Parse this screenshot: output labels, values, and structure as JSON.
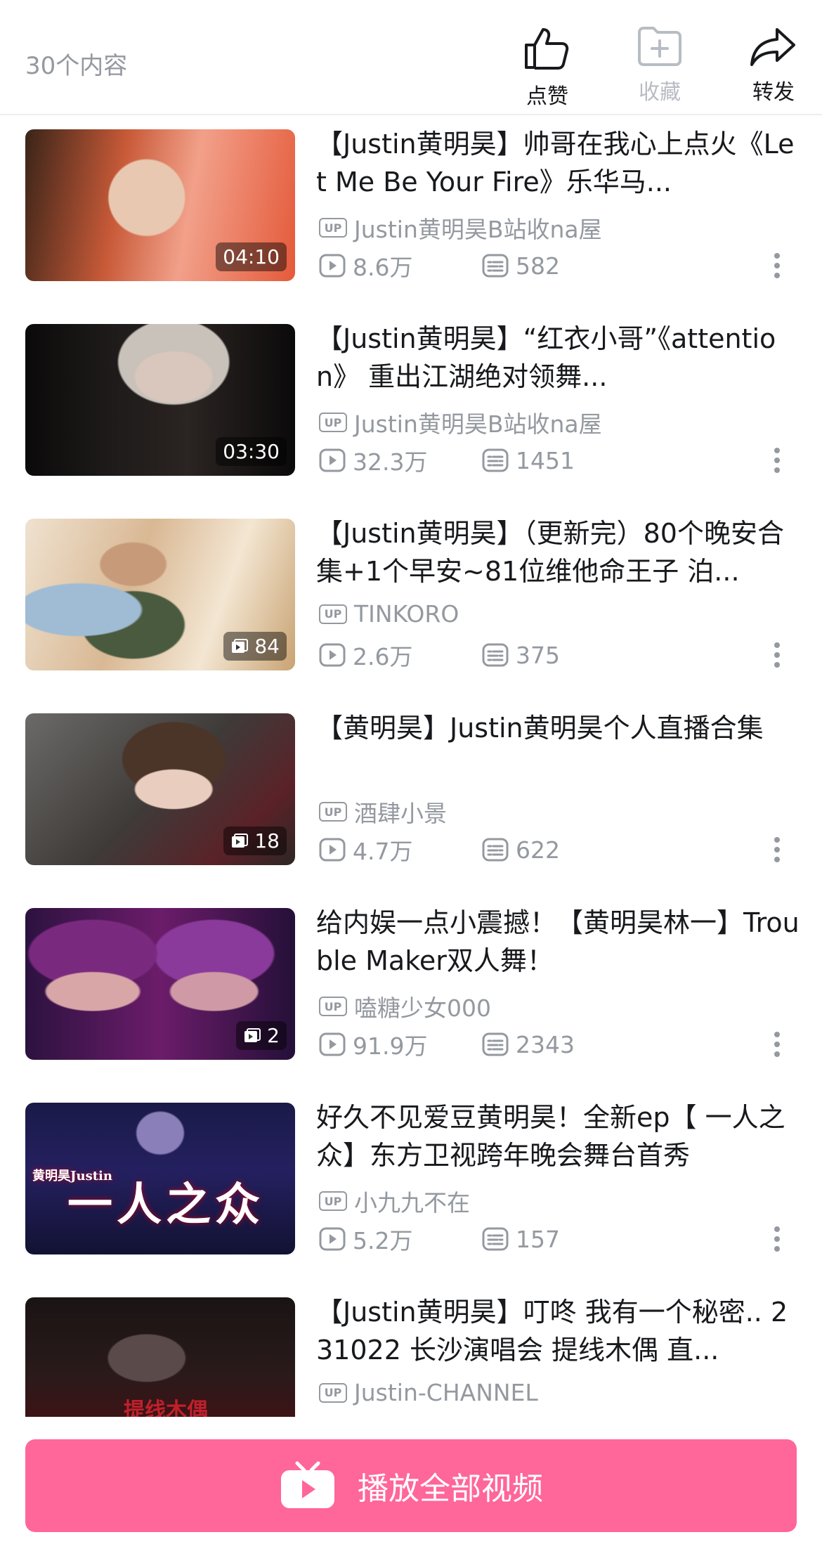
{
  "header": {
    "count_label": "30个内容",
    "actions": [
      {
        "label": "点赞",
        "icon": "thumbs-up-icon"
      },
      {
        "label": "收藏",
        "icon": "folder-plus-icon",
        "disabled": true
      },
      {
        "label": "转发",
        "icon": "share-arrow-icon"
      }
    ]
  },
  "videos": [
    {
      "title": "【Justin黄明昊】帅哥在我心上点火《Let Me Be Your Fire》乐华马...",
      "uploader": "Justin黄明昊B站收na屋",
      "plays": "8.6万",
      "danmaku": "582",
      "badge": "04:10",
      "badge_type": "duration"
    },
    {
      "title": "【Justin黄明昊】“红衣小哥”《attention》 重出江湖绝对领舞...",
      "uploader": "Justin黄明昊B站收na屋",
      "plays": "32.3万",
      "danmaku": "1451",
      "badge": "03:30",
      "badge_type": "duration"
    },
    {
      "title": "【Justin黄明昊】（更新完）80个晚安合集+1个早安~81位维他命王子 泊...",
      "uploader": "TINKORO",
      "plays": "2.6万",
      "danmaku": "375",
      "badge": "84",
      "badge_type": "pages"
    },
    {
      "title": "【黄明昊】Justin黄明昊个人直播合集",
      "uploader": "酒肆小景",
      "plays": "4.7万",
      "danmaku": "622",
      "badge": "18",
      "badge_type": "pages"
    },
    {
      "title": "给内娱一点小震撼！【黄明昊林一】Trouble Maker双人舞！",
      "uploader": "嗑糖少女000",
      "plays": "91.9万",
      "danmaku": "2343",
      "badge": "2",
      "badge_type": "pages"
    },
    {
      "title": "好久不见爱豆黄明昊！全新ep【 一人之众】东方卫视跨年晚会舞台首秀",
      "uploader": "小九九不在",
      "plays": "5.2万",
      "danmaku": "157",
      "badge": "",
      "badge_type": "none",
      "thumb_text": "一人之众",
      "thumb_text_small": "黄明昊Justin"
    },
    {
      "title": "【Justin黄明昊】叮咚 我有一个秘密.. 231022 长沙演唱会 提线木偶 直...",
      "uploader": "Justin-CHANNEL",
      "plays": "",
      "danmaku": "",
      "badge": "",
      "badge_type": "none",
      "thumb_text": "提线木偶"
    }
  ],
  "labels": {
    "up_badge": "UP"
  },
  "play_all": {
    "label": "播放全部视频"
  },
  "colors": {
    "accent": "#ff6699",
    "muted": "#9499a0",
    "text": "#18191c"
  }
}
